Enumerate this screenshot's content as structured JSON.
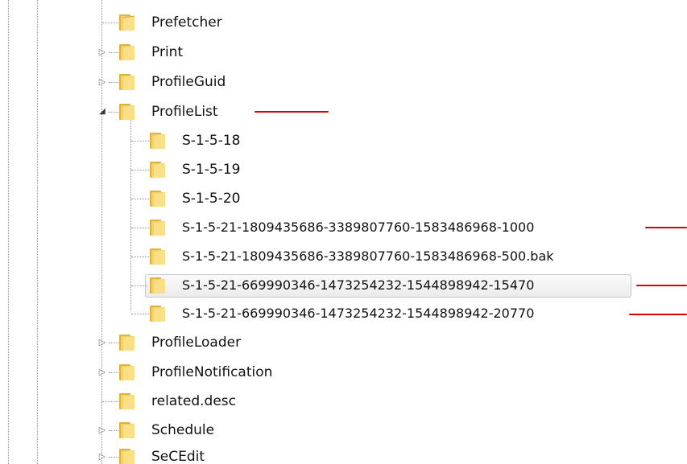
{
  "tree": {
    "top_items": [
      {
        "label": "Prefetcher",
        "expander": ""
      },
      {
        "label": "Print",
        "expander": "▷"
      },
      {
        "label": "ProfileGuid",
        "expander": "▷"
      }
    ],
    "profile_list": {
      "label": "ProfileList",
      "expander": "◢",
      "children": [
        {
          "label": "S-1-5-18"
        },
        {
          "label": "S-1-5-19"
        },
        {
          "label": "S-1-5-20"
        },
        {
          "label": "S-1-5-21-1809435686-3389807760-1583486968-1000"
        },
        {
          "label": "S-1-5-21-1809435686-3389807760-1583486968-500.bak"
        },
        {
          "label": "S-1-5-21-669990346-1473254232-1544898942-15470"
        },
        {
          "label": "S-1-5-21-669990346-1473254232-1544898942-20770"
        }
      ]
    },
    "bottom_items": [
      {
        "label": "ProfileLoader",
        "expander": "▷"
      },
      {
        "label": "ProfileNotification",
        "expander": "▷"
      },
      {
        "label": "related.desc",
        "expander": ""
      },
      {
        "label": "Schedule",
        "expander": "▷"
      },
      {
        "label": "SeCEdit",
        "expander": "▷"
      }
    ]
  },
  "colors": {
    "annotation_line": "#d90000",
    "folder_body": "#f2c84b",
    "folder_front": "#f9df86",
    "selection_border": "#c7c7c7"
  },
  "icons": {
    "folder": "folder-icon",
    "collapsed": "expand-arrow-icon",
    "expanded": "collapse-arrow-icon"
  }
}
